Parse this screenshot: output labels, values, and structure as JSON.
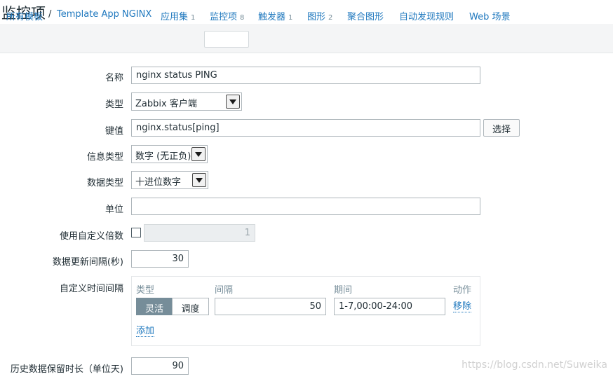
{
  "page": {
    "title": "监控项"
  },
  "nav": {
    "crumb_root": "所有模板",
    "crumb_sep": "/",
    "crumb_template": "Template App NGINX",
    "tabs": [
      {
        "label": "应用集",
        "count": "1"
      },
      {
        "label": "监控项",
        "count": "8"
      },
      {
        "label": "触发器",
        "count": "1"
      },
      {
        "label": "图形",
        "count": "2"
      },
      {
        "label": "聚合图形",
        "count": ""
      },
      {
        "label": "自动发现规则",
        "count": ""
      },
      {
        "label": "Web 场景",
        "count": ""
      }
    ]
  },
  "form": {
    "name_label": "名称",
    "name_value": "nginx status PING",
    "type_label": "类型",
    "type_value": "Zabbix 客户端",
    "key_label": "键值",
    "key_value": "nginx.status[ping]",
    "select_button": "选择",
    "info_type_label": "信息类型",
    "info_type_value": "数字 (无正负)",
    "data_type_label": "数据类型",
    "data_type_value": "十进位数字",
    "unit_label": "单位",
    "unit_value": "",
    "multiplier_label": "使用自定义倍数",
    "multiplier_value": "1",
    "interval_label": "数据更新间隔(秒)",
    "interval_value": "30",
    "custom_intervals_label": "自定义时间间隔",
    "custom": {
      "col_type": "类型",
      "col_interval": "间隔",
      "col_period": "期间",
      "col_action": "动作",
      "seg_flexible": "灵活",
      "seg_scheduling": "调度",
      "row_interval": "50",
      "row_period": "1-7,00:00-24:00",
      "remove": "移除",
      "add": "添加"
    },
    "history_label": "历史数据保留时长（单位天)",
    "history_value": "90"
  },
  "watermark": "https://blog.csdn.net/Suweika",
  "colors": {
    "link": "#1f78be",
    "segment_active": "#768d99"
  }
}
